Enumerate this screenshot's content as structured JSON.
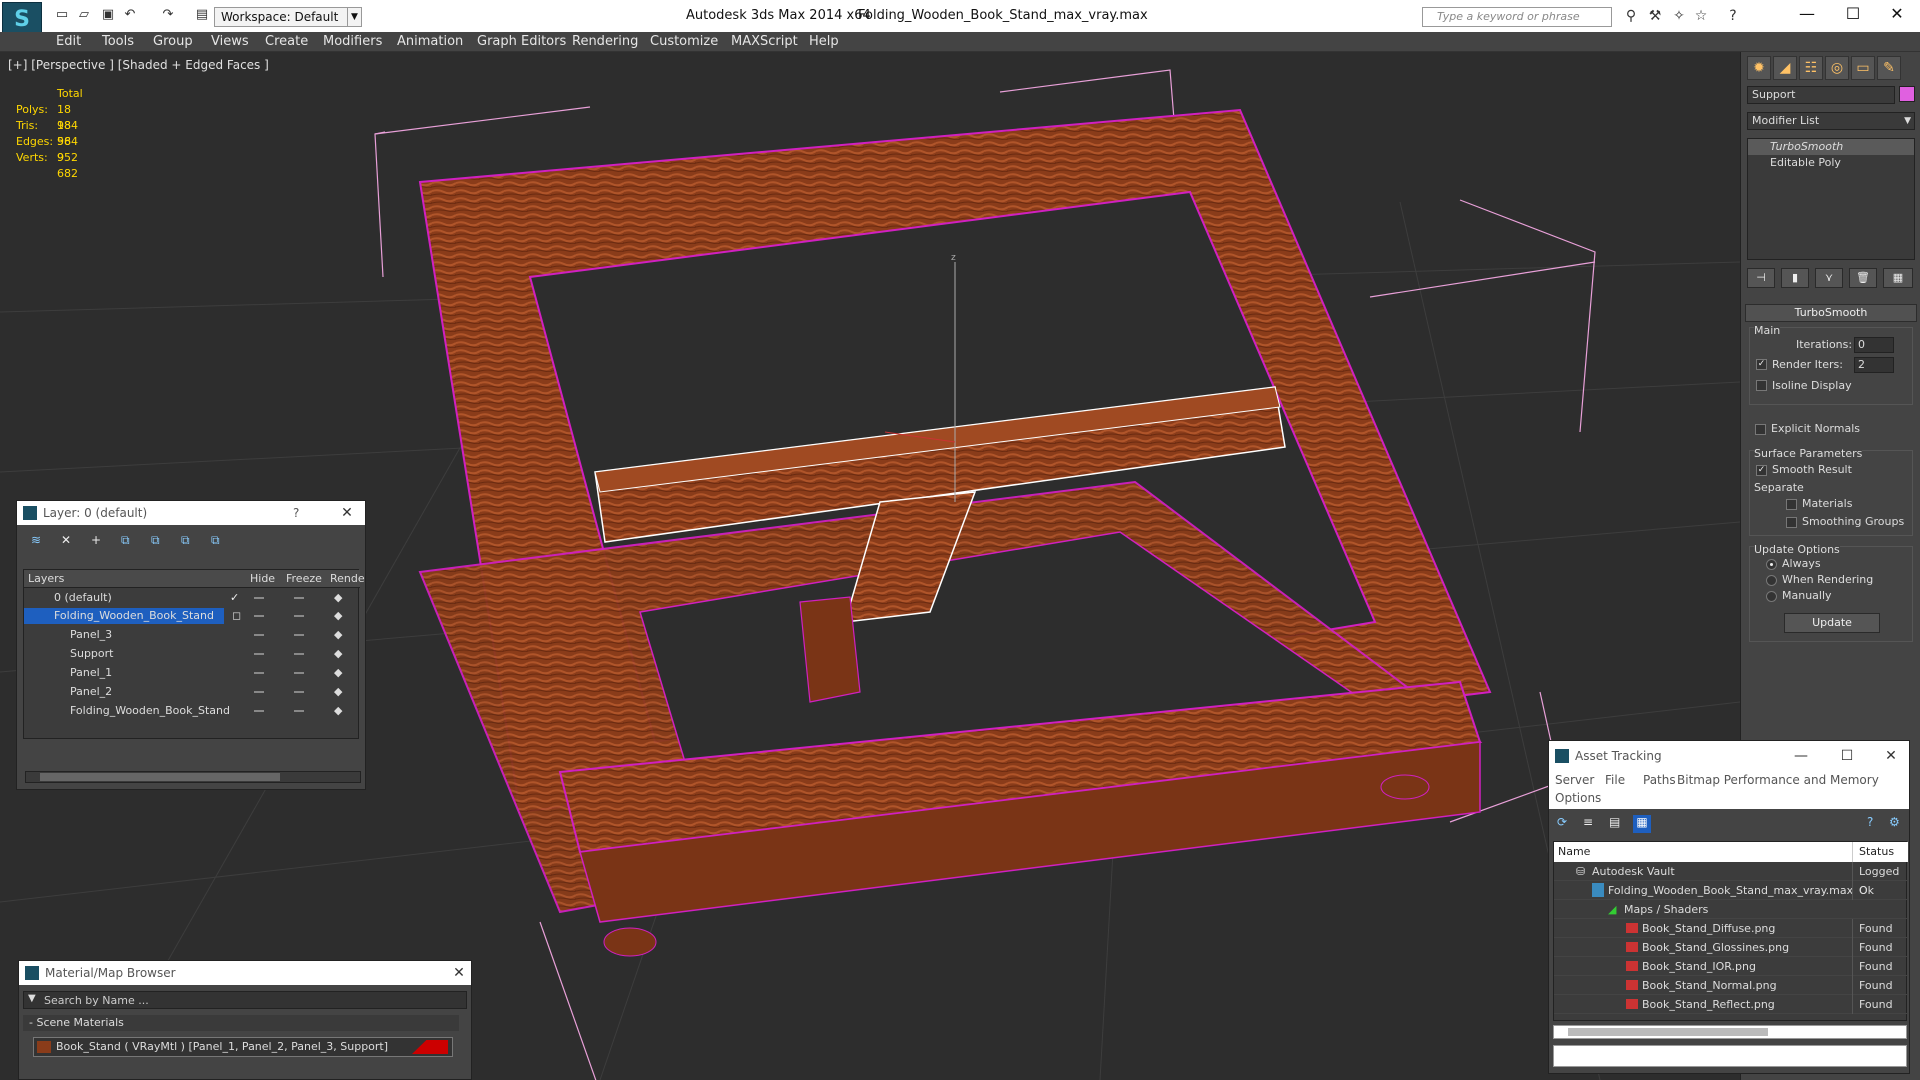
{
  "titlebar": {
    "workspace": "Workspace: Default",
    "app_title": "Autodesk 3ds Max  2014 x64",
    "file_title": "Folding_Wooden_Book_Stand_max_vray.max",
    "search_placeholder": "Type a keyword or phrase"
  },
  "menu": [
    "Edit",
    "Tools",
    "Group",
    "Views",
    "Create",
    "Modifiers",
    "Animation",
    "Graph Editors",
    "Rendering",
    "Customize",
    "MAXScript",
    "Help"
  ],
  "viewport": {
    "label": "[+] [Perspective ] [Shaded + Edged Faces ]",
    "stats": {
      "header": "Total",
      "rows": [
        {
          "k": "Polys:",
          "v": "18 984"
        },
        {
          "k": "Tris:",
          "v": "18 984"
        },
        {
          "k": "Edges:",
          "v": "56 952"
        },
        {
          "k": "Verts:",
          "v": "9 682"
        }
      ]
    },
    "axis_label": "z"
  },
  "command_panel": {
    "object_name": "Support",
    "object_color": "#e060e0",
    "modifier_list": "Modifier List",
    "stack": [
      "TurboSmooth",
      "Editable Poly"
    ],
    "turbosmooth": {
      "title": "TurboSmooth",
      "main": "Main",
      "iterations_label": "Iterations:",
      "iterations": "0",
      "render_iters_label": "Render Iters:",
      "render_iters": "2",
      "render_iters_checked": true,
      "isoline": "Isoline Display",
      "explicit_normals": "Explicit Normals",
      "surface_params": "Surface Parameters",
      "smooth_result": "Smooth Result",
      "smooth_result_checked": true,
      "separate": "Separate",
      "materials": "Materials",
      "smoothing_groups": "Smoothing Groups",
      "update_options": "Update Options",
      "always": "Always",
      "when_rendering": "When Rendering",
      "manually": "Manually",
      "update_button": "Update"
    }
  },
  "layer_window": {
    "title": "Layer: 0 (default)",
    "help": "?",
    "columns": [
      "Layers",
      "Hide",
      "Freeze",
      "Rende"
    ],
    "rows": [
      {
        "name": "0 (default)",
        "indent": 1,
        "selected": false,
        "current": true
      },
      {
        "name": "Folding_Wooden_Book_Stand",
        "indent": 1,
        "selected": true,
        "current": false
      },
      {
        "name": "Panel_3",
        "indent": 2,
        "selected": false,
        "current": false
      },
      {
        "name": "Support",
        "indent": 2,
        "selected": false,
        "current": false
      },
      {
        "name": "Panel_1",
        "indent": 2,
        "selected": false,
        "current": false
      },
      {
        "name": "Panel_2",
        "indent": 2,
        "selected": false,
        "current": false
      },
      {
        "name": "Folding_Wooden_Book_Stand",
        "indent": 2,
        "selected": false,
        "current": false
      }
    ]
  },
  "material_browser": {
    "title": "Material/Map Browser",
    "search_placeholder": "Search by Name ...",
    "section": "- Scene Materials",
    "material": "Book_Stand  ( VRayMtl )  [Panel_1, Panel_2, Panel_3, Support]"
  },
  "asset_tracking": {
    "title": "Asset Tracking",
    "menu": [
      "Server",
      "File",
      "Paths",
      "Bitmap Performance and Memory",
      "Options"
    ],
    "columns": [
      "Name",
      "Status"
    ],
    "rows": [
      {
        "name": "Autodesk Vault",
        "status": "Logged O",
        "indent": 1,
        "icon": "vault"
      },
      {
        "name": "Folding_Wooden_Book_Stand_max_vray.max",
        "status": "Ok",
        "indent": 2,
        "icon": "max"
      },
      {
        "name": "Maps / Shaders",
        "status": "",
        "indent": 3,
        "icon": "maps"
      },
      {
        "name": "Book_Stand_Diffuse.png",
        "status": "Found",
        "indent": 4,
        "icon": "png"
      },
      {
        "name": "Book_Stand_Glossines.png",
        "status": "Found",
        "indent": 4,
        "icon": "png"
      },
      {
        "name": "Book_Stand_IOR.png",
        "status": "Found",
        "indent": 4,
        "icon": "png"
      },
      {
        "name": "Book_Stand_Normal.png",
        "status": "Found",
        "indent": 4,
        "icon": "png"
      },
      {
        "name": "Book_Stand_Reflect.png",
        "status": "Found",
        "indent": 4,
        "icon": "png"
      }
    ]
  },
  "colors": {
    "wood": "#8a3c1a",
    "wood_light": "#b0552a",
    "wireframe": "#d020c0",
    "bbox": "#e8a0d8",
    "selection": "#1e5fbf",
    "stats": "#ffd700"
  }
}
